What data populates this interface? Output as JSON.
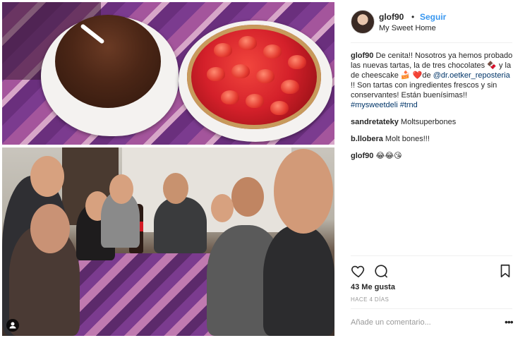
{
  "photos": {
    "top_alt": "tartas",
    "bottom_alt": "cena"
  },
  "header": {
    "username": "glof90",
    "separator": "•",
    "follow_label": "Seguir",
    "location": "My Sweet Home"
  },
  "caption": {
    "user": "glof90",
    "text_1": " De cenita!! Nosotros ya hemos probado las nuevas tartas, la de tres chocolates 🍫 y la de cheescake 🍰 ❤️de ",
    "mention": "@dr.oetker_reposteria",
    "text_2": " !! Son tartas con ingredientes frescos y sin conservantes! Están buenísimas!! ",
    "hashtag_1": "#mysweetdeli",
    "hashtag_2": "#trnd"
  },
  "comments": [
    {
      "user": "sandretateky",
      "text": " Moltsuperbones"
    },
    {
      "user": "b.llobera",
      "text": " Molt bones!!!"
    },
    {
      "user": "glof90",
      "text": " 😂😂😘"
    }
  ],
  "stats": {
    "likes": "43 Me gusta",
    "time": "HACE 4 DÍAS"
  },
  "composer": {
    "placeholder": "Añade un comentario...",
    "more": "•••"
  },
  "icons": {
    "like": "heart-icon",
    "comment": "comment-bubble-icon",
    "save": "bookmark-icon",
    "camera": "user-tag-icon"
  }
}
